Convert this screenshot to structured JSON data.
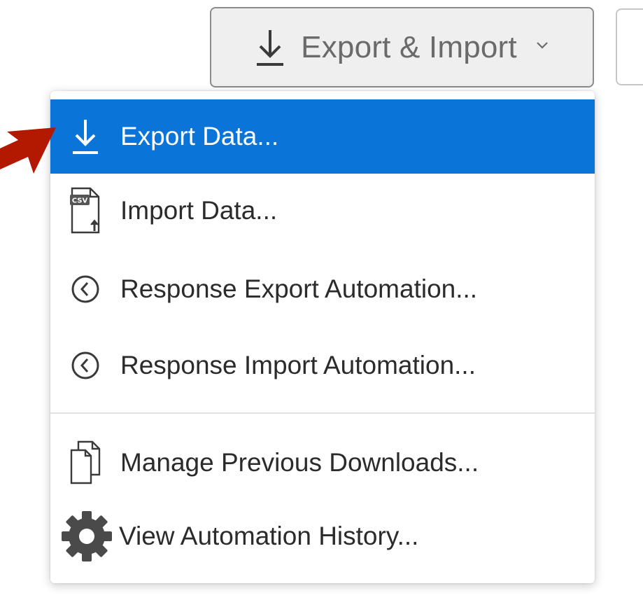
{
  "toolbar": {
    "export_import_label": "Export & Import",
    "export_import_icon": "download-icon",
    "dropdown_icon": "chevron-down-icon"
  },
  "menu": {
    "items": [
      {
        "label": "Export Data...",
        "icon": "download-icon",
        "selected": true
      },
      {
        "label": "Import Data...",
        "icon": "csv-file-upload-icon",
        "selected": false
      },
      {
        "label": "Response Export Automation...",
        "icon": "clock-icon",
        "selected": false
      },
      {
        "label": "Response Import Automation...",
        "icon": "clock-icon",
        "selected": false
      },
      {
        "label": "Manage Previous Downloads...",
        "icon": "documents-icon",
        "selected": false
      },
      {
        "label": "View Automation History...",
        "icon": "gear-icon",
        "selected": false
      }
    ]
  },
  "annotation": {
    "pointer": "red-arrow-icon",
    "color": "#b31800"
  },
  "colors": {
    "accent": "#0b74d9",
    "button_bg": "#efefef"
  }
}
